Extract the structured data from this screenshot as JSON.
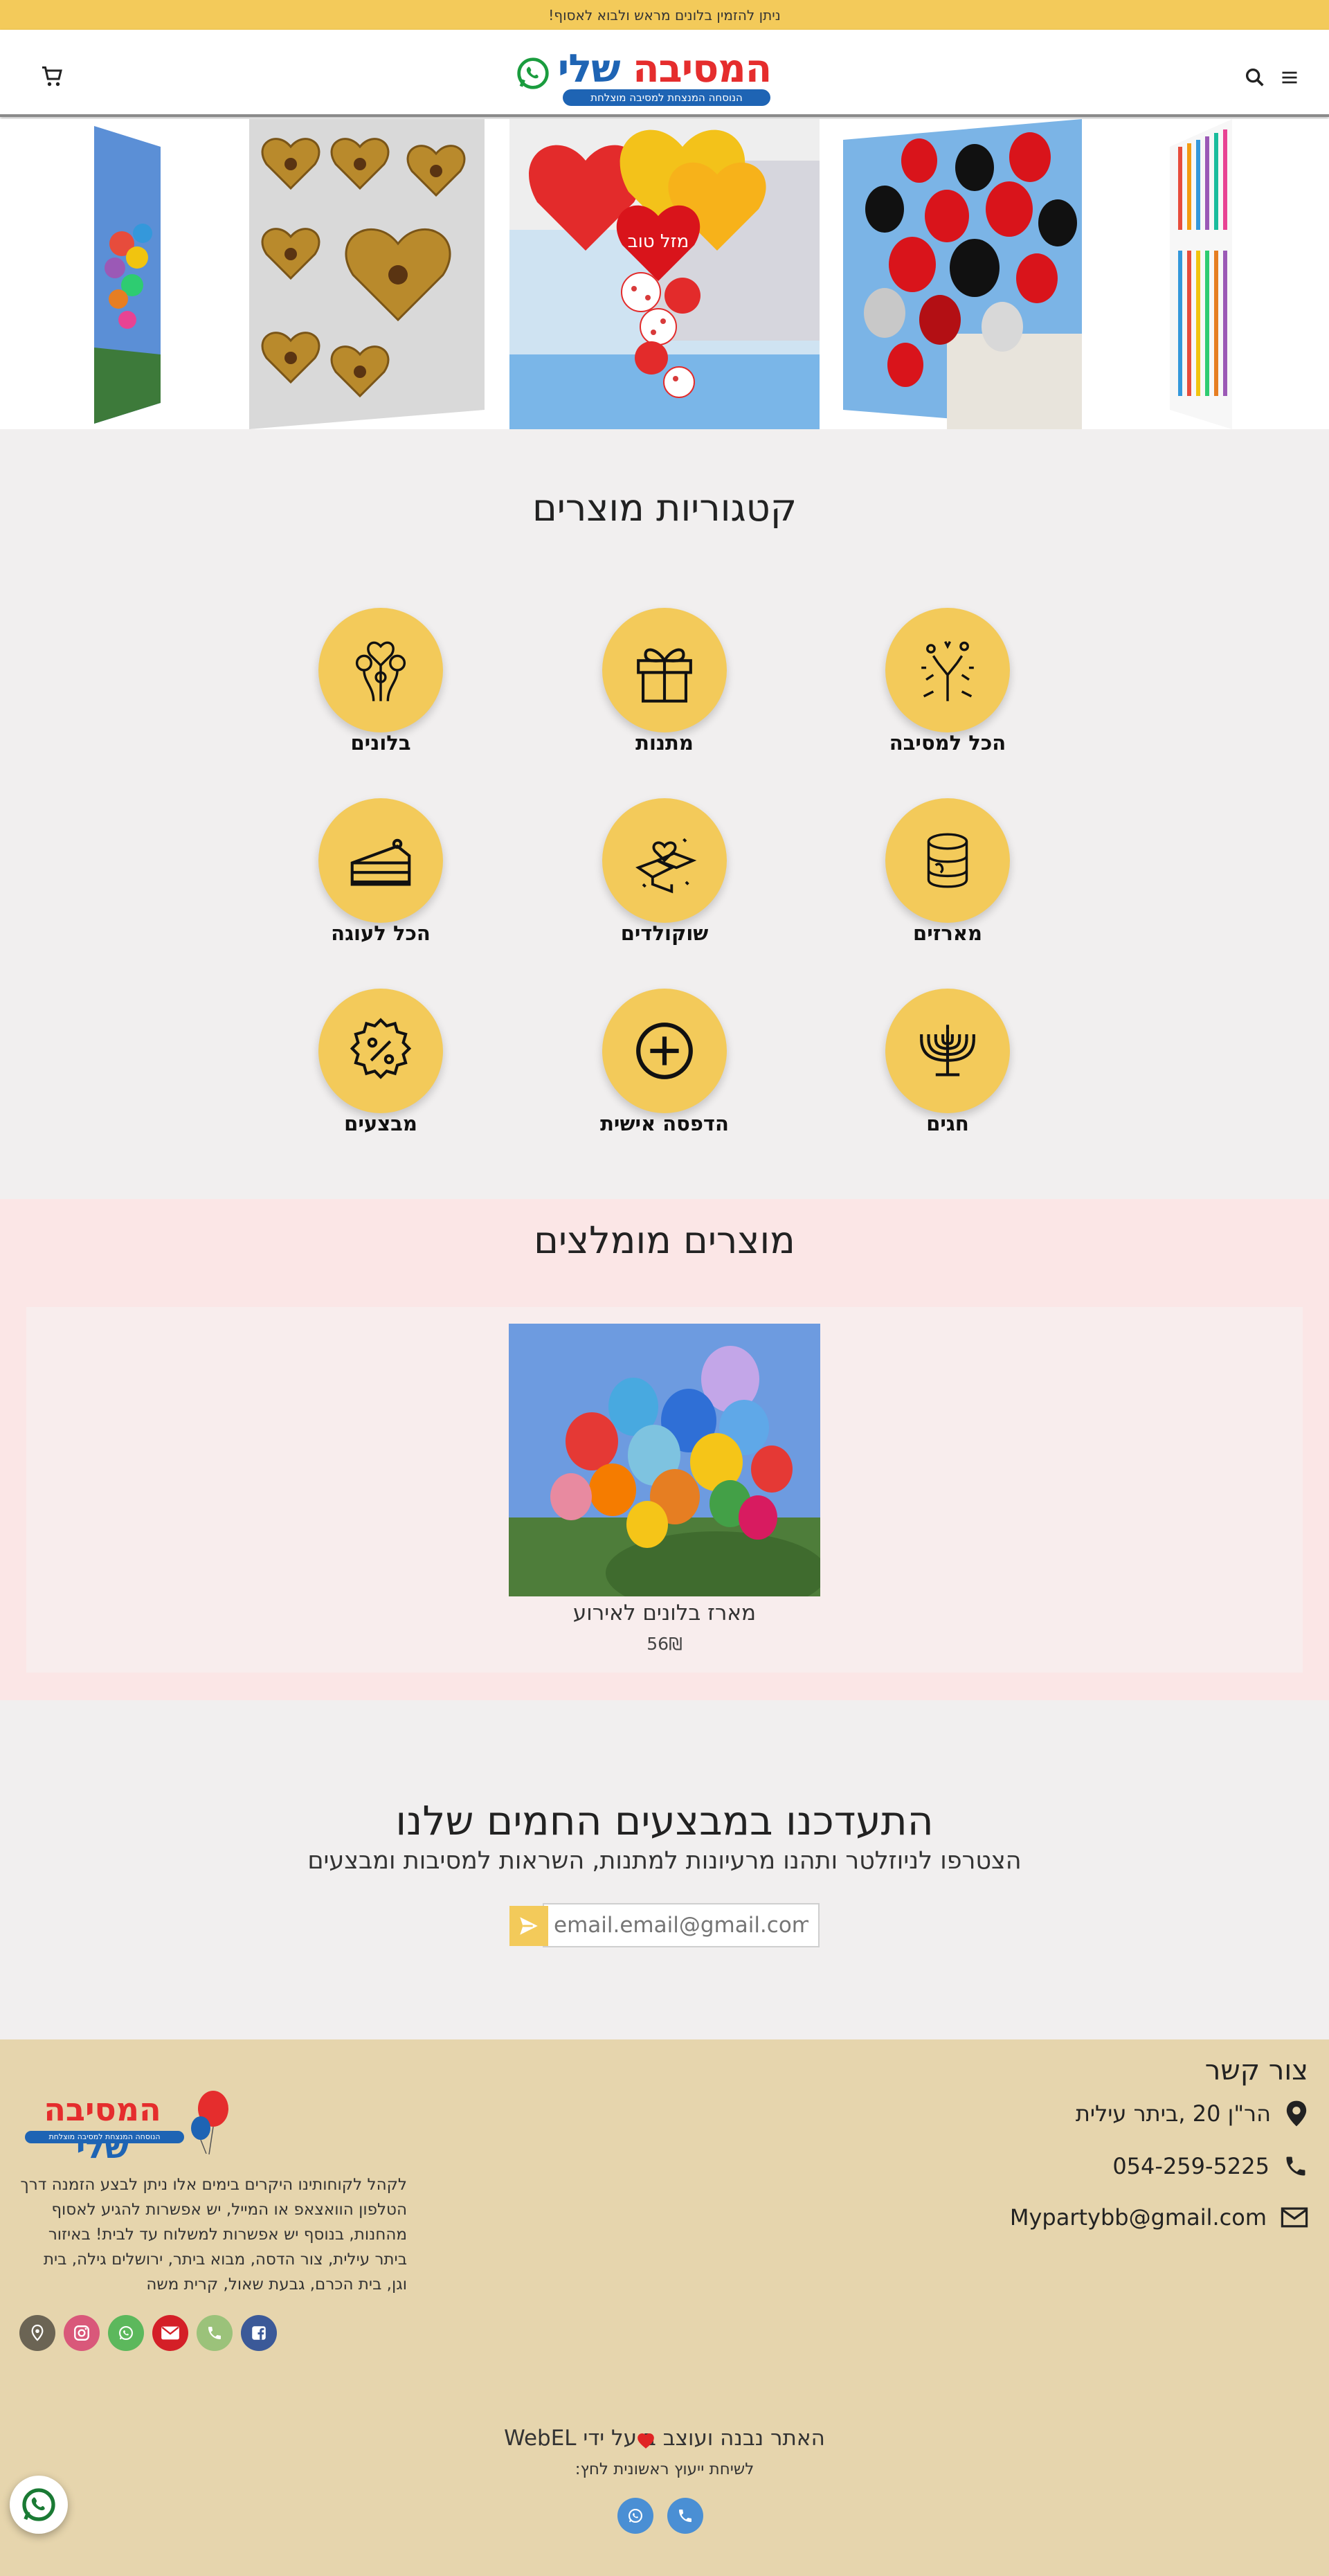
{
  "announcement": "ניתן להזמין בלונים מראש ולבוא לאסוף!",
  "logo": {
    "name_part1": "המסיבה",
    "name_part2": "שלי",
    "tagline": "הנוסחה המנצחת למסיבה מוצלחת"
  },
  "header_icons": [
    "menu-icon",
    "search-icon",
    "cart-icon",
    "whatsapp-icon"
  ],
  "carousel": {
    "slides": [
      "balloons-sky",
      "heart-chocolates",
      "heart-balloons-mazal-tov",
      "black-red-balloons",
      "colorful-candles"
    ],
    "heart_text": "מזל טוב"
  },
  "categories": {
    "title": "קטגוריות מוצרים",
    "items": [
      {
        "label": "הכל למסיבה",
        "icon": "fireworks-icon"
      },
      {
        "label": "מתנות",
        "icon": "gift-icon"
      },
      {
        "label": "בלונים",
        "icon": "balloons-icon"
      },
      {
        "label": "מארזים",
        "icon": "package-icon"
      },
      {
        "label": "שוקולדים",
        "icon": "chocolate-icon"
      },
      {
        "label": "הכל לעוגה",
        "icon": "cake-icon"
      },
      {
        "label": "חגים",
        "icon": "menorah-icon"
      },
      {
        "label": "הדפסה אישית",
        "icon": "plus-icon"
      },
      {
        "label": "מבצעים",
        "icon": "percent-badge-icon"
      }
    ]
  },
  "recommended": {
    "title": "מוצרים מומלצים",
    "products": [
      {
        "name": "מארז בלונים לאירוע",
        "price": "56₪"
      }
    ]
  },
  "newsletter": {
    "title": "התעדכנו במבצעים החמים שלנו",
    "subtitle": "הצטרפו לניוזלטר ותהנו מרעיונות למתנות, השראות למסיבות ומבצעים",
    "placeholder": "email.email@gmail.com"
  },
  "footer": {
    "contact_title": "צור קשר",
    "address": "הר\"ן 20 ,ביתר עילית",
    "phone": "054-259-5225",
    "email": "Mypartybb@gmail.com",
    "about": "לקהל לקוחותינו היקרים בימים אלו ניתן לבצע הזמנה דרך הטלפון הוואצאפ או המייל, יש אפשרות להגיע לאסוף מהחנות, בנוסף יש אפשרות למשלוח עד לבית! באיזור ביתר עילית, צור הדסה, מבוא ביתר, ירושלים גילה, בית וגן, בית הכרם, גבעת שאול, קרית משה",
    "socials": [
      "facebook-icon",
      "phone-icon",
      "email-icon",
      "whatsapp-icon",
      "instagram-icon",
      "location-icon"
    ],
    "social_colors": [
      "#3b5998",
      "#9bc27a",
      "#d41f27",
      "#5cb85c",
      "#d9587a",
      "#6b6454"
    ],
    "credit": "האתר נבנה ועוצב ב  על ידי WebEL",
    "credit_sub": "לשיחת ייעוץ ראשונית לחץ:"
  },
  "colors": {
    "accent": "#f3ca5a",
    "footer_bg": "#e6d5ad",
    "brand_red": "#e52d2d",
    "brand_blue": "#1e64b4"
  }
}
